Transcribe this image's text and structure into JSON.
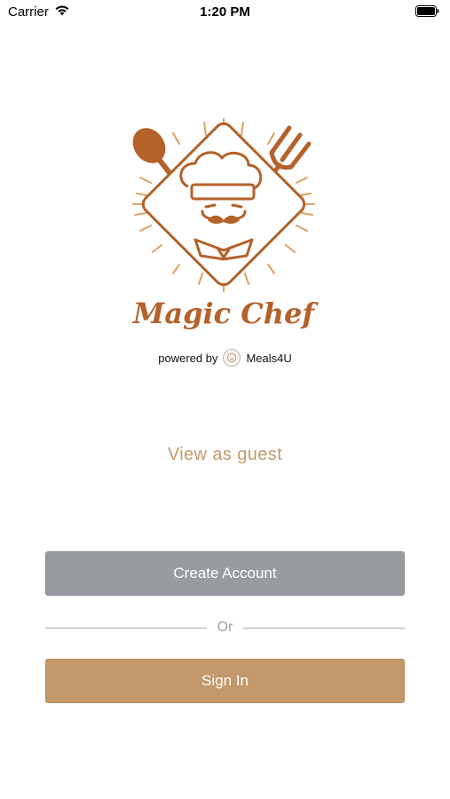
{
  "status_bar": {
    "carrier": "Carrier",
    "time": "1:20 PM"
  },
  "logo": {
    "app_name": "Magic Chef",
    "brand_color": "#b4612a"
  },
  "powered_by": {
    "prefix": "powered by",
    "brand": "Meals4U"
  },
  "guest": {
    "label": "View as guest",
    "color": "#c49a6c"
  },
  "actions": {
    "create_account_label": "Create Account",
    "create_account_color": "#989ca1",
    "or_label": "Or",
    "sign_in_label": "Sign In",
    "sign_in_color": "#c3986a"
  },
  "icons": [
    "wifi-icon",
    "battery-icon",
    "spoon-icon",
    "fork-icon",
    "chef-hat-icon",
    "meals4u-icon"
  ]
}
